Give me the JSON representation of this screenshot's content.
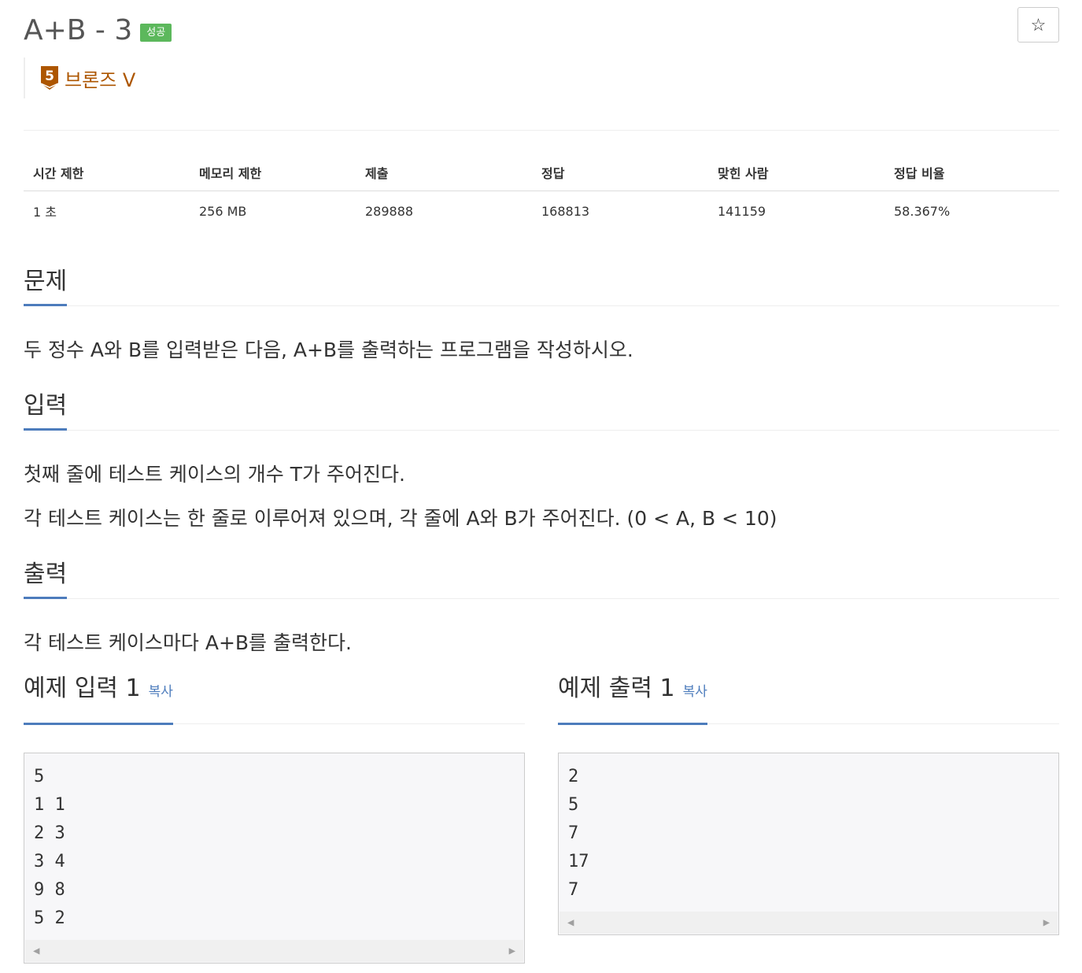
{
  "problem": {
    "title": "A+B - 3",
    "status_badge": "성공",
    "star_icon": "☆",
    "tier": {
      "number": "5",
      "label": "브론즈 V",
      "color": "#ad5600"
    }
  },
  "info_table": {
    "headers": [
      "시간 제한",
      "메모리 제한",
      "제출",
      "정답",
      "맞힌 사람",
      "정답 비율"
    ],
    "values": [
      "1 초",
      "256 MB",
      "289888",
      "168813",
      "141159",
      "58.367%"
    ]
  },
  "sections": {
    "description": {
      "title": "문제",
      "text": "두 정수 A와 B를 입력받은 다음, A+B를 출력하는 프로그램을 작성하시오."
    },
    "input": {
      "title": "입력",
      "lines": [
        "첫째 줄에 테스트 케이스의 개수 T가 주어진다.",
        "각 테스트 케이스는 한 줄로 이루어져 있으며, 각 줄에 A와 B가 주어진다. (0 < A, B < 10)"
      ]
    },
    "output": {
      "title": "출력",
      "text": "각 테스트 케이스마다 A+B를 출력한다."
    }
  },
  "samples": {
    "input": {
      "title": "예제 입력 1",
      "copy_label": "복사",
      "content": "5\n1 1\n2 3\n3 4\n9 8\n5 2"
    },
    "output": {
      "title": "예제 출력 1",
      "copy_label": "복사",
      "content": "2\n5\n7\n17\n7"
    }
  },
  "colors": {
    "accent": "#4d7cbc",
    "success": "#5cb85c",
    "bronze": "#ad5600"
  }
}
